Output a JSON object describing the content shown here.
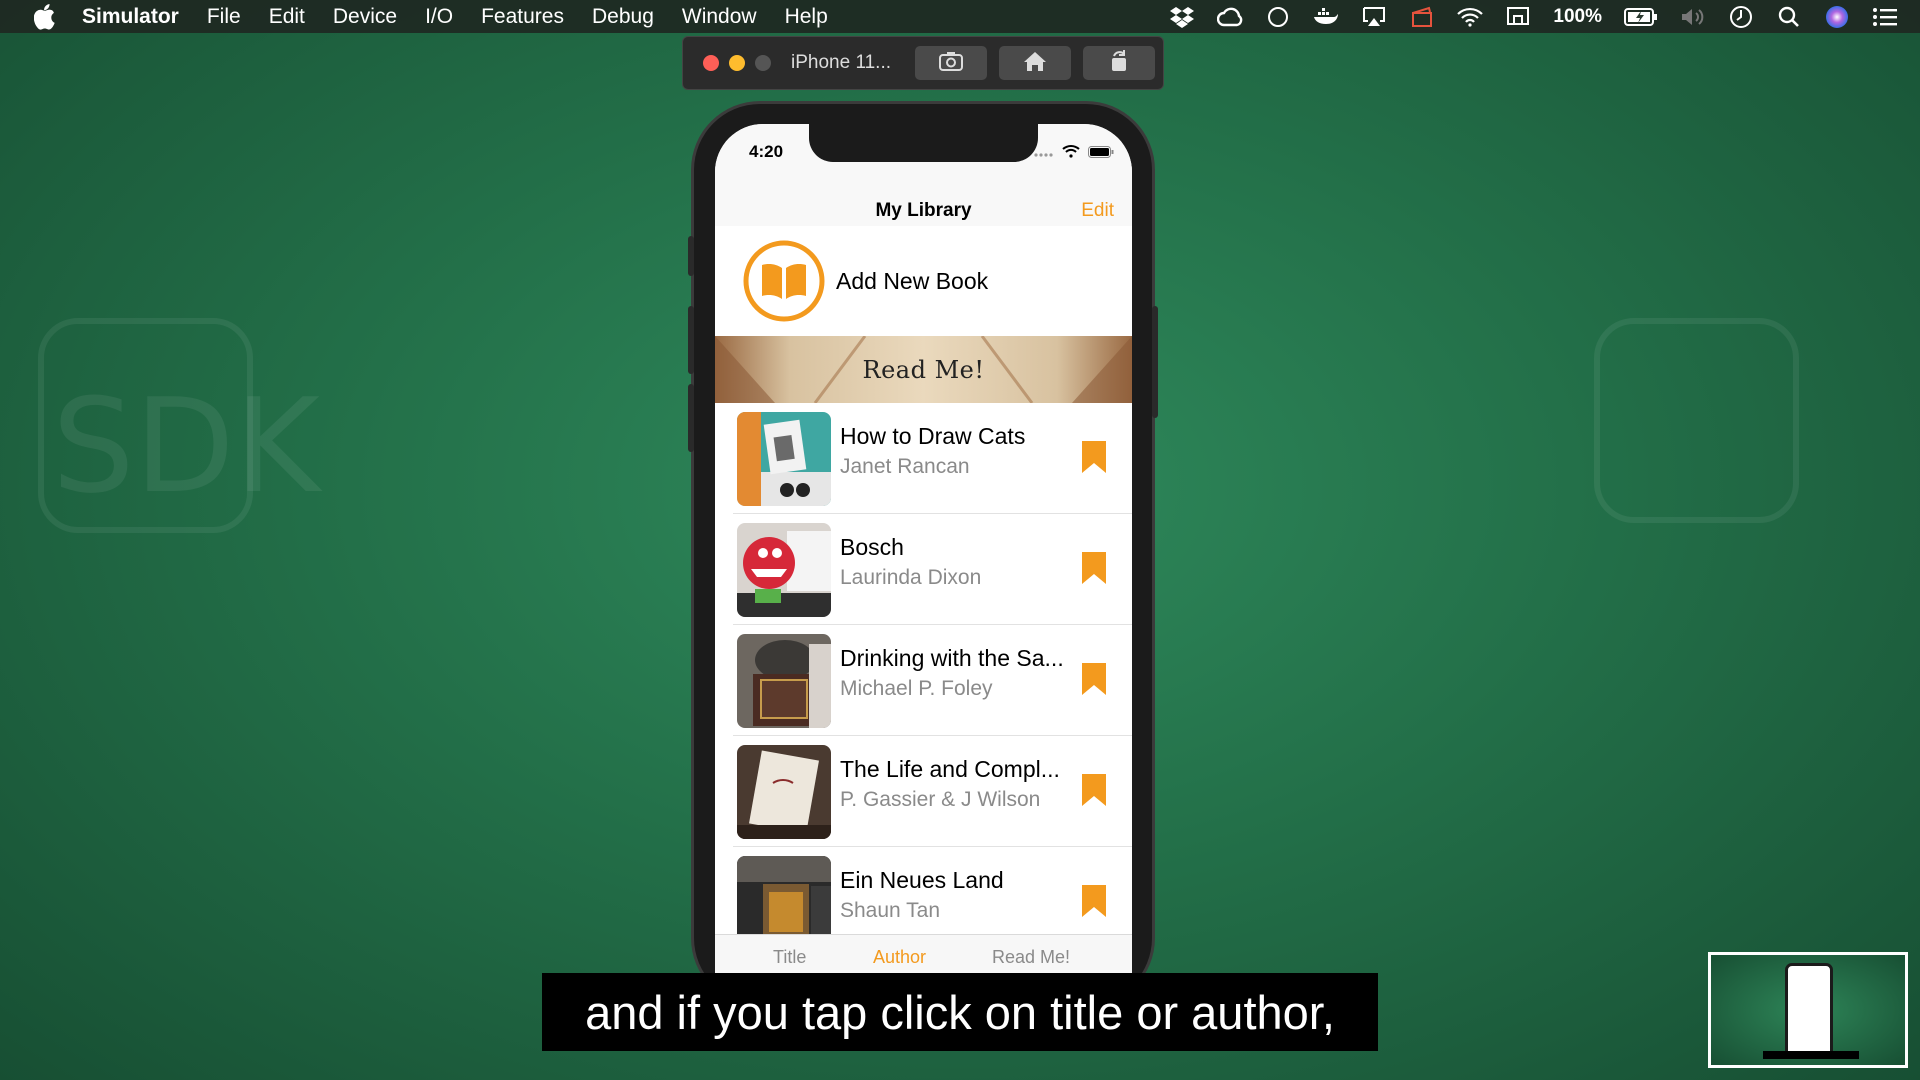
{
  "menubar": {
    "app_name": "Simulator",
    "items": [
      "File",
      "Edit",
      "Device",
      "I/O",
      "Features",
      "Debug",
      "Window",
      "Help"
    ],
    "battery": "100%",
    "status_icons": [
      "dropbox-icon",
      "creative-cloud-icon",
      "circle-icon",
      "docker-icon",
      "airplay-icon",
      "clapper-icon",
      "wifi-icon",
      "display-icon",
      "battery-icon",
      "volume-icon",
      "clock-icon",
      "search-icon",
      "siri-icon",
      "list-icon"
    ]
  },
  "simulator": {
    "title": "iPhone 11...",
    "buttons": [
      "screenshot-icon",
      "home-icon",
      "rotate-icon"
    ]
  },
  "phone": {
    "status_time": "4:20",
    "nav": {
      "title": "My Library",
      "edit_label": "Edit"
    },
    "add_book": {
      "label": "Add New Book"
    },
    "section_header": "Read Me!",
    "books": [
      {
        "title": "How to Draw Cats",
        "author": "Janet Rancan"
      },
      {
        "title": "Bosch",
        "author": "Laurinda Dixon"
      },
      {
        "title": "Drinking with the Sa...",
        "author": "Michael P. Foley"
      },
      {
        "title": "The Life and Compl...",
        "author": "P. Gassier & J Wilson"
      },
      {
        "title": "Ein Neues Land",
        "author": "Shaun Tan"
      }
    ],
    "tabs": [
      {
        "label": "Title",
        "active": false
      },
      {
        "label": "Author",
        "active": true
      },
      {
        "label": "Read Me!",
        "active": false
      }
    ]
  },
  "caption": "and if you tap click on title or author,",
  "colors": {
    "accent": "#f39a1e",
    "desktop_green": "#237049",
    "author_gray": "#8a8a8a"
  }
}
